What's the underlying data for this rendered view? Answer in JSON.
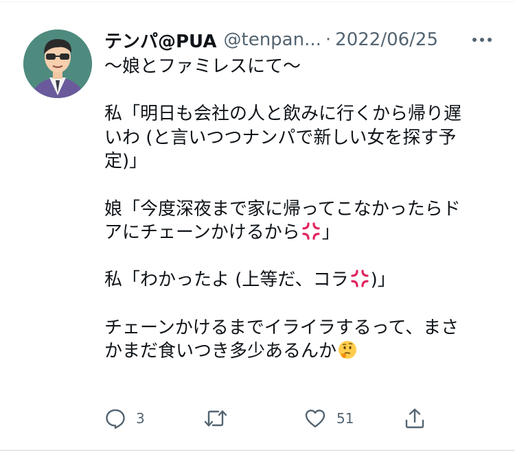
{
  "tweet": {
    "author": {
      "display_name": "テンパ@PUA",
      "handle": "@tenpan...",
      "avatar_icon": "cartoon-man-sunglasses-avatar"
    },
    "separator": "·",
    "date": "2022/06/25",
    "body": {
      "p1": {
        "l1": "〜娘とファミレスにて〜"
      },
      "p2": {
        "l1": "私「明日も会社の人と飲みに行くから帰り遅",
        "l2": "いわ (と言いつつナンパで新しい女を探す予",
        "l3": "定)」"
      },
      "p3": {
        "l1": "娘「今度深夜まで家に帰ってこなかったらド",
        "l2a": "アにチェーンかけるから",
        "l2b": "」"
      },
      "p4": {
        "l1a": "私「わかったよ (上等だ、コラ",
        "l1b": ")」"
      },
      "p5": {
        "l1": "チェーンかけるまでイライラするって、まさ",
        "l2": "かまだ食いつき多少あるんか"
      }
    },
    "emojis": {
      "anger": "anger-symbol-emoji",
      "thinking": "thinking-face-emoji"
    },
    "actions": {
      "reply": {
        "icon": "reply-icon",
        "count": "3"
      },
      "retweet": {
        "icon": "retweet-icon",
        "count": ""
      },
      "like": {
        "icon": "heart-icon",
        "count": "51"
      },
      "share": {
        "icon": "share-icon",
        "count": ""
      }
    },
    "more_icon": "more-options-icon"
  },
  "colors": {
    "text": "#0f1419",
    "secondary": "#536471",
    "anger": "#e0245e",
    "thinking": "#ffcc4d"
  }
}
